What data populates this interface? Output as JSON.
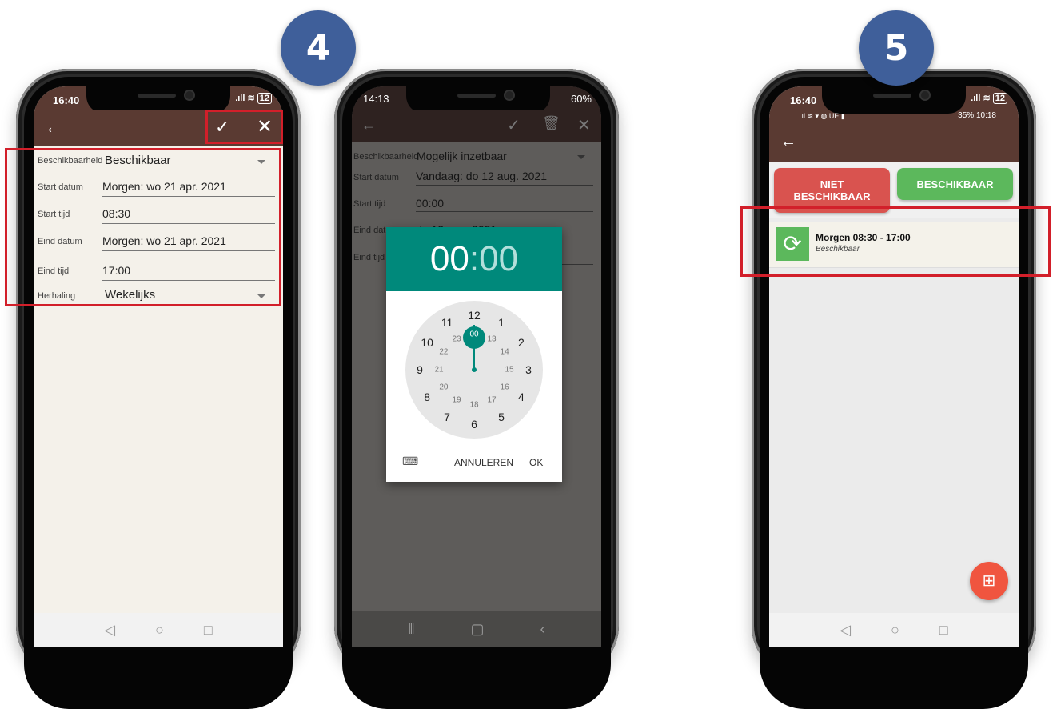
{
  "steps": {
    "step4": "4",
    "step5": "5"
  },
  "phone1": {
    "status_time": "16:40",
    "battery": "12",
    "fields": [
      {
        "label": "Beschikbaarheid",
        "value": "Beschikbaar"
      },
      {
        "label": "Start datum",
        "value": "Morgen: wo 21 apr. 2021"
      },
      {
        "label": "Start tijd",
        "value": "08:30"
      },
      {
        "label": "Eind datum",
        "value": "Morgen: wo 21 apr. 2021"
      },
      {
        "label": "Eind tijd",
        "value": "17:00"
      },
      {
        "label": "Herhaling",
        "value": "Wekelijks"
      }
    ]
  },
  "phone2": {
    "status_time": "14:13",
    "battery_pct": "60%",
    "fields": [
      {
        "label": "Beschikbaarheid",
        "value": "Mogelijk inzetbaar"
      },
      {
        "label": "Start datum",
        "value": "Vandaag: do 12 aug. 2021"
      },
      {
        "label": "Start tijd",
        "value": "00:00"
      },
      {
        "label": "Eind datum",
        "value": "do 12 aug. 2021"
      },
      {
        "label": "Eind tijd",
        "value": ""
      }
    ],
    "picker": {
      "hours": "00",
      "separator": ":",
      "minutes": "00",
      "outer_numbers": [
        "12",
        "1",
        "2",
        "3",
        "4",
        "5",
        "6",
        "7",
        "8",
        "9",
        "10",
        "11"
      ],
      "inner_numbers": [
        "00",
        "13",
        "14",
        "15",
        "16",
        "17",
        "18",
        "19",
        "20",
        "21",
        "22",
        "23"
      ],
      "cancel_label": "ANNULEREN",
      "ok_label": "OK"
    }
  },
  "phone3": {
    "status_time": "16:40",
    "battery": "12",
    "sub_status_right": "35%  10:18",
    "buttons": {
      "unavailable": "NIET BESCHIKBAAR",
      "available": "BESCHIKBAAR"
    },
    "item": {
      "title": "Morgen 08:30 - 17:00",
      "subtitle": "Beschikbaar"
    }
  },
  "colors": {
    "appbar": "#5a3a32",
    "accent_teal": "#00897b",
    "red_button": "#d9534f",
    "green_button": "#5cb85c",
    "highlight": "#d21f2a",
    "fab": "#f0553f"
  }
}
